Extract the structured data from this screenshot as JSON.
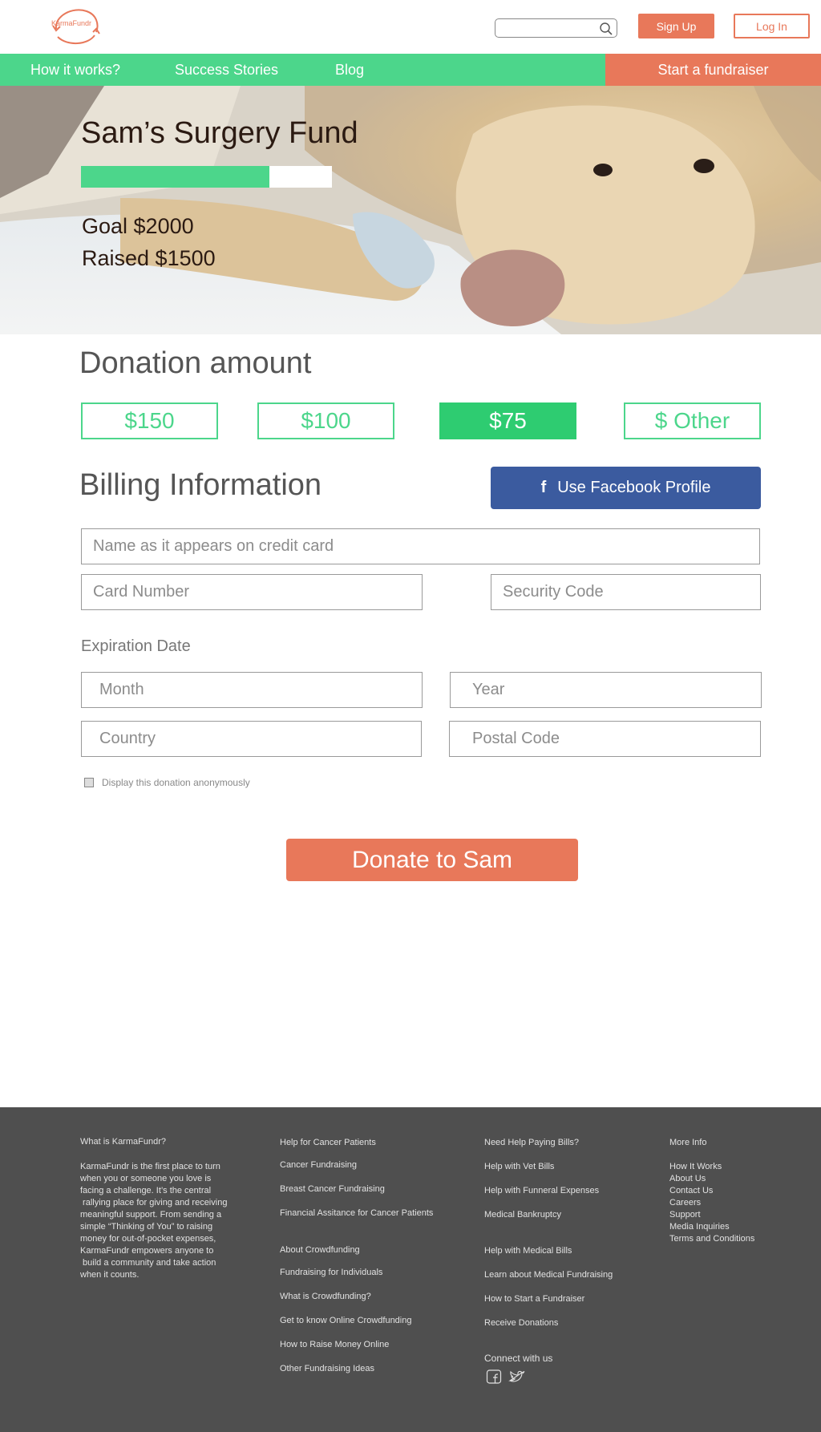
{
  "header": {
    "logo_text": "KarmaFundr",
    "search_placeholder": "",
    "signup_label": "Sign Up",
    "login_label": "Log In"
  },
  "nav": {
    "items": [
      "How it works?",
      "Success Stories",
      "Blog"
    ],
    "cta_label": "Start a fundraiser"
  },
  "hero": {
    "title": "Sam’s Surgery Fund",
    "goal": "Goal $2000",
    "raised": "Raised $1500",
    "progress_fraction": 0.75
  },
  "donation": {
    "title": "Donation amount",
    "amounts": [
      "$150",
      "$100",
      "$75",
      "$ Other"
    ],
    "selected": "$75"
  },
  "billing": {
    "title": "Billing Information",
    "facebook_label": "Use Facebook Profile",
    "name_placeholder": "Name as it appears on credit card",
    "card_placeholder": "Card Number",
    "security_placeholder": "Security Code",
    "expiration_label": "Expiration Date",
    "month_placeholder": "Month",
    "year_placeholder": "Year",
    "country_placeholder": "Country",
    "postal_placeholder": "Postal Code",
    "anonymous_label": "Display this donation anonymously",
    "donate_label": "Donate to Sam"
  },
  "colors": {
    "green": "#4cd68b",
    "orange": "#e8785a",
    "facebook": "#3b5b9f",
    "footer_bg": "#4f4f4f"
  },
  "footer": {
    "about_title": "What is KarmaFundr?",
    "about_lines": [
      "KarmaFundr is the first place to turn",
      "when you or someone you love is",
      "facing a challenge. It’s the central",
      " rallying place for giving and receiving",
      "meaningful support. From sending a",
      "simple “Thinking of You” to raising",
      "money for out-of-pocket expenses,",
      "KarmaFundr empowers anyone to",
      " build a community and take action",
      "when it counts."
    ],
    "col2a": [
      "Help for Cancer Patients",
      "Cancer Fundraising",
      "Breast Cancer Fundraising",
      "Financial Assitance for Cancer Patients"
    ],
    "col2b": [
      "About Crowdfunding",
      "Fundraising for Individuals",
      "What is Crowdfunding?",
      "Get to know Online Crowdfunding",
      "How to Raise Money Online",
      "Other Fundraising Ideas"
    ],
    "col3a": [
      "Need Help Paying Bills?",
      "Help with Vet Bills",
      "Help with Funneral Expenses",
      "Medical Bankruptcy"
    ],
    "col3b": [
      "Help with Medical Bills",
      "Learn about Medical Fundraising",
      "How to Start a Fundraiser",
      "Receive Donations"
    ],
    "connect_label": "Connect with us",
    "more_title": "More Info",
    "more_links": [
      "How It Works",
      "About Us",
      "Contact Us",
      "Careers",
      "Support",
      "Media Inquiries",
      "Terms and Conditions"
    ]
  }
}
